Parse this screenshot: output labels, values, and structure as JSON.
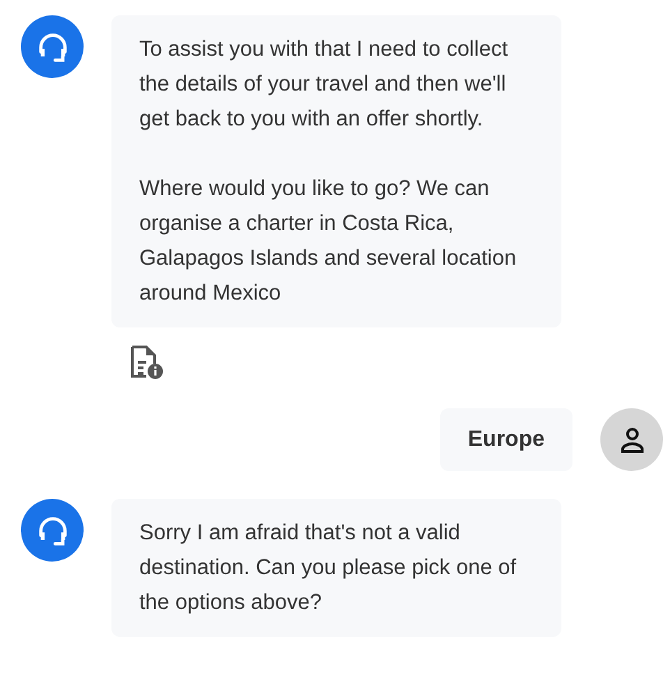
{
  "messages": [
    {
      "kind": "bot",
      "paragraphs": [
        "To assist you with that I need to collect the details of your travel and then we'll get back to you with an offer shortly.",
        "Where would you like to go? We can organise a charter in Costa Rica, Galapagos Islands and several location around Mexico"
      ],
      "details_icon": true
    },
    {
      "kind": "user",
      "paragraphs": [
        "Europe"
      ]
    },
    {
      "kind": "bot",
      "paragraphs": [
        "Sorry I am afraid that's not a valid destination. Can you please pick one of the options above?"
      ]
    }
  ]
}
